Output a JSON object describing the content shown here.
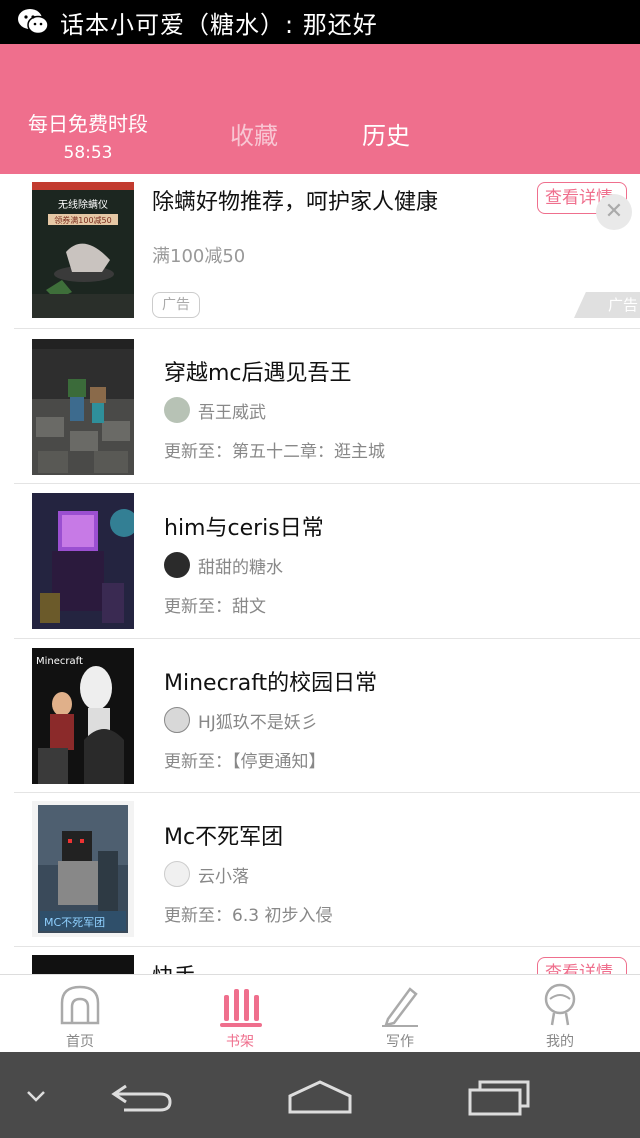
{
  "status_bar": {
    "notification": "话本小可爱（糖水）: 那还好"
  },
  "header": {
    "free_label": "每日免费时段",
    "free_timer": "58:53",
    "tab_favorites": "收藏",
    "tab_history": "历史"
  },
  "ad": {
    "title": "除螨好物推荐，呵护家人健康",
    "subtitle": "满100减50",
    "tag": "广告",
    "button": "查看详情",
    "mark": "广告",
    "cover_text_1": "无线除螨仪",
    "cover_text_2": "领券满100减50"
  },
  "books": [
    {
      "title": "穿越mc后遇见吾王",
      "author": "吾王威武",
      "update": "更新至：第五十二章：逛主城"
    },
    {
      "title": "him与ceris日常",
      "author": "甜甜的糖水",
      "update": "更新至：甜文"
    },
    {
      "title": "Minecraft的校园日常",
      "author": "HJ狐玖不是妖彡",
      "update": "更新至：【停更通知】"
    },
    {
      "title": "Mc不死军团",
      "author": "云小落",
      "update": "更新至：6.3 初步入侵"
    },
    {
      "title": "快手",
      "button": "查看详情"
    }
  ],
  "bottom_nav": [
    {
      "label": "首页",
      "icon": "home-icon"
    },
    {
      "label": "书架",
      "icon": "bookshelf-icon",
      "active": true
    },
    {
      "label": "写作",
      "icon": "pen-icon"
    },
    {
      "label": "我的",
      "icon": "profile-icon"
    }
  ],
  "colors": {
    "accent": "#ef6f8d",
    "header_bg": "#ef6f8d",
    "status_bg": "#000000",
    "system_nav_bg": "#4a4a4a"
  }
}
